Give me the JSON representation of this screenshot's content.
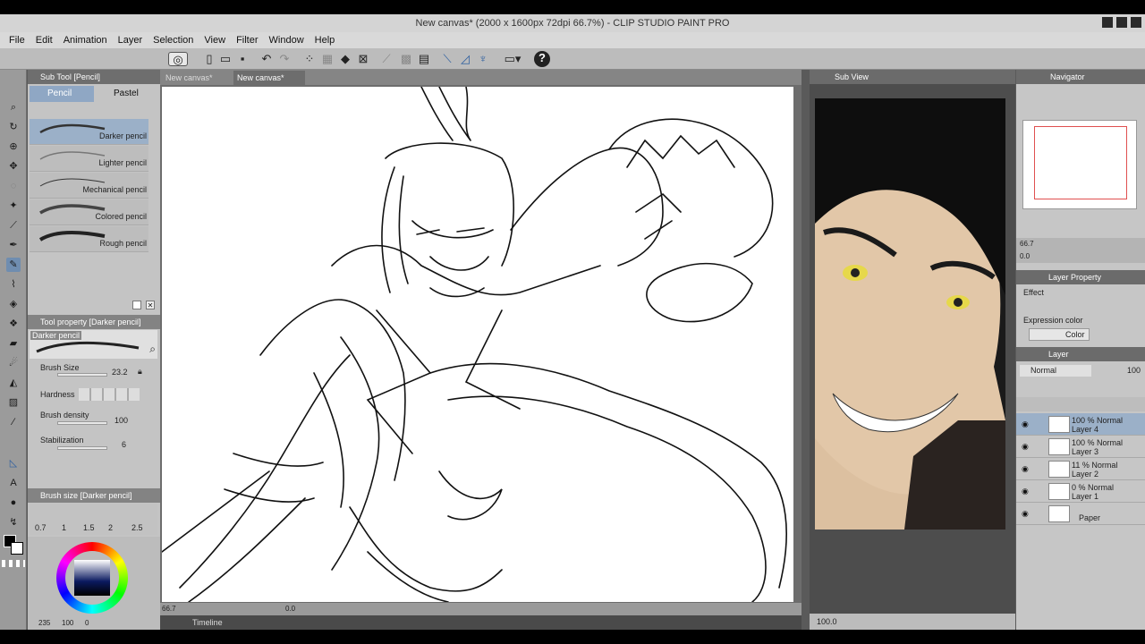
{
  "window": {
    "title": "New canvas* (2000 x 1600px 72dpi 66.7%) - CLIP STUDIO PAINT PRO"
  },
  "menu": [
    "File",
    "Edit",
    "Animation",
    "Layer",
    "Selection",
    "View",
    "Filter",
    "Window",
    "Help"
  ],
  "subtool": {
    "title": "Sub Tool [Pencil]",
    "tabs": [
      "Pencil",
      "Pastel"
    ],
    "brushes": [
      "Darker pencil",
      "Lighter pencil",
      "Mechanical pencil",
      "Colored pencil",
      "Rough pencil"
    ]
  },
  "toolprop": {
    "title": "Tool property [Darker pencil]",
    "preview_label": "Darker pencil",
    "brush_size_label": "Brush Size",
    "brush_size": "23.2",
    "hardness_label": "Hardness",
    "density_label": "Brush density",
    "density": "100",
    "stab_label": "Stabilization",
    "stab": "6"
  },
  "brushsize": {
    "title": "Brush size [Darker pencil]",
    "values": [
      "0.7",
      "1",
      "1.5",
      "2",
      "2.5"
    ]
  },
  "color": {
    "readout": "235",
    "readout2": "100",
    "readout3": "0"
  },
  "canvas": {
    "tabs": [
      "New canvas*",
      "New canvas*"
    ],
    "zoom": "66.7",
    "coords": "0.0"
  },
  "timeline": {
    "label": "Timeline"
  },
  "subview": {
    "title": "Sub View",
    "zoom": "100.0"
  },
  "navigator": {
    "title": "Navigator",
    "zoom": "66.7",
    "angle": "0.0"
  },
  "layerprop": {
    "title": "Layer Property",
    "effect": "Effect",
    "expr_label": "Expression color",
    "expr_value": "Color"
  },
  "layers": {
    "title": "Layer",
    "blend": "Normal",
    "opacity": "100",
    "items": [
      {
        "line1": "100 % Normal",
        "line2": "Layer 4"
      },
      {
        "line1": "100 % Normal",
        "line2": "Layer 3"
      },
      {
        "line1": "11 % Normal",
        "line2": "Layer 2"
      },
      {
        "line1": "0 % Normal",
        "line2": "Layer 1"
      },
      {
        "line1": "",
        "line2": "Paper"
      }
    ]
  }
}
